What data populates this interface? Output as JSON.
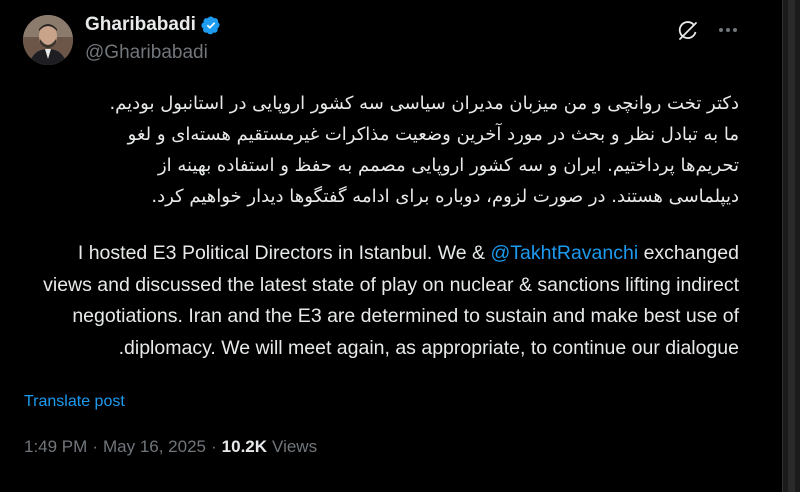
{
  "author": {
    "display_name": "Gharibabadi",
    "handle": "@Gharibabadi",
    "verified": true,
    "accent_color": "#1d9bf0"
  },
  "post": {
    "text_fa": [
      "دکتر تخت روانچی و من میزبان مدیران سیاسی سه کشور اروپایی در استانبول بودیم.",
      "ما به تبادل نظر و بحث در مورد آخرین وضعیت مذاکرات غیرمستقیم هسته‌ای و لغو",
      "تحریم‌ها پرداختیم. ایران و سه کشور اروپایی مصمم به حفظ و استفاده بهینه از",
      "دیپلماسی هستند. در صورت لزوم، دوباره برای ادامه گفتگوها دیدار خواهیم کرد."
    ],
    "text_en_part1": "I hosted E3 Political Directors in Istanbul. We & ",
    "mention": "@TakhtRavanchi",
    "text_en_part2": " exchanged views and discussed the latest state of play on nuclear & sanctions lifting indirect negotiations. Iran and the E3 are determined to sustain and make best use of diplomacy. We will meet again, as appropriate, to continue our dialogue."
  },
  "actions": {
    "translate_label": "Translate post",
    "grok_icon": "grok-icon",
    "more_icon": "more-icon"
  },
  "meta": {
    "time": "1:49 PM",
    "date": "May 16, 2025",
    "separator": "·",
    "views_count": "10.2K",
    "views_label": "Views"
  }
}
